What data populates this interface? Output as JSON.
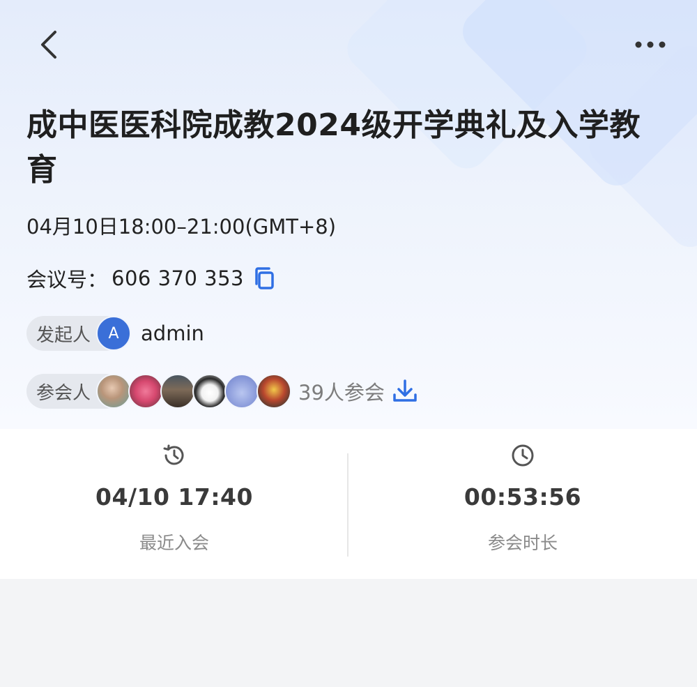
{
  "header": {
    "back_icon": "chevron-left-icon",
    "more_icon": "more-horizontal-icon"
  },
  "meeting": {
    "title": "成中医医科院成教2024级开学典礼及入学教育",
    "time": "04月10日18:00–21:00(GMT+8)",
    "id_label": "会议号：",
    "id_value": "606 370 353",
    "copy_icon": "copy-icon",
    "host_label": "发起人",
    "host_initial": "A",
    "host_name": "admin",
    "host_avatar_color": "#3a6fd8",
    "attendee_label": "参会人",
    "attendee_count_text": "39人参会",
    "download_icon": "download-icon"
  },
  "stats": {
    "last_join_value": "04/10 17:40",
    "last_join_label": "最近入会",
    "last_join_icon": "history-icon",
    "duration_value": "00:53:56",
    "duration_label": "参会时长",
    "duration_icon": "clock-icon"
  },
  "colors": {
    "accent": "#2f6fe4",
    "text_primary": "#1f1f1f",
    "text_secondary": "#8a8a8a"
  }
}
